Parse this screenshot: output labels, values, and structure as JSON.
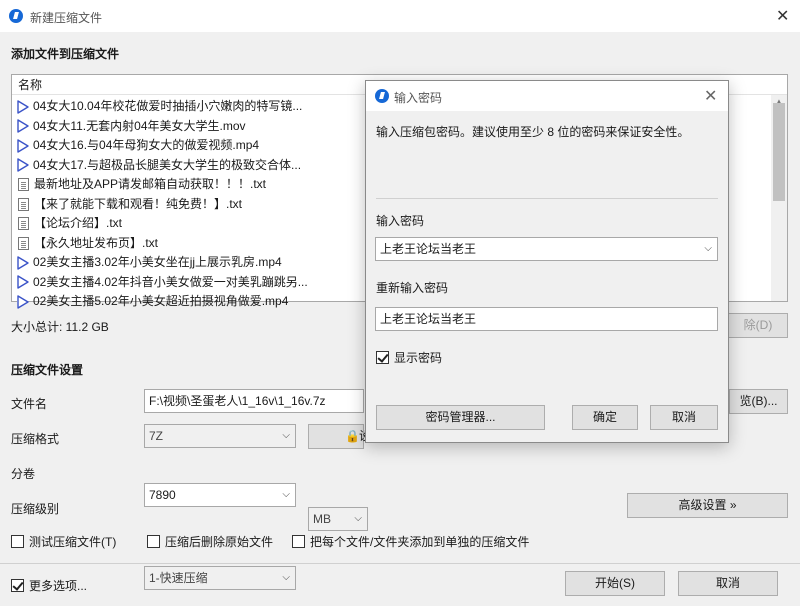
{
  "window": {
    "title": "新建压缩文件"
  },
  "section_add": "添加文件到压缩文件",
  "file_list": {
    "header": "名称",
    "items": [
      {
        "name": "04女大10.04年校花做爱时抽插小穴嫩肉的特写镜...",
        "type": "video"
      },
      {
        "name": "04女大11.无套内射04年美女大学生.mov",
        "type": "video"
      },
      {
        "name": "04女大16.与04年母狗女大的做爱视频.mp4",
        "type": "video"
      },
      {
        "name": "04女大17.与超极品长腿美女大学生的极致交合体...",
        "type": "video"
      },
      {
        "name": "最新地址及APP请发邮箱自动获取！！！.txt",
        "type": "text"
      },
      {
        "name": "【来了就能下载和观看！纯免费！】.txt",
        "type": "text"
      },
      {
        "name": "【论坛介绍】.txt",
        "type": "text"
      },
      {
        "name": "【永久地址发布页】.txt",
        "type": "text"
      },
      {
        "name": "02美女主播3.02年小美女坐在jj上展示乳房.mp4",
        "type": "video"
      },
      {
        "name": "02美女主播4.02年抖音小美女做爱一对美乳蹦跳另...",
        "type": "video"
      },
      {
        "name": "02美女主播5.02年小美女超近拍摄视角做爱.mp4",
        "type": "video"
      }
    ]
  },
  "total_size": "大小总计: 11.2 GB",
  "remove_button": "除(D)",
  "section_settings": "压缩文件设置",
  "settings": {
    "filename_label": "文件名",
    "filename_value": "F:\\视频\\圣蛋老人\\1_16v\\1_16v.7z",
    "browse_button": "览(B)...",
    "format_label": "压缩格式",
    "format_value": "7Z",
    "password_button": "设",
    "split_label": "分卷",
    "split_value": "7890",
    "split_unit": "MB",
    "level_label": "压缩级别",
    "level_value": "1-快速压缩",
    "advanced_button": "高级设置 »"
  },
  "options": {
    "test": "测试压缩文件(T)",
    "delete_original": "压缩后删除原始文件",
    "separate": "把每个文件/文件夹添加到单独的压缩文件"
  },
  "more_options": "更多选项...",
  "start_button": "开始(S)",
  "cancel_button": "取消",
  "password_dialog": {
    "title": "输入密码",
    "description": "输入压缩包密码。建议使用至少 8 位的密码来保证安全性。",
    "password_label": "输入密码",
    "password_value": "上老王论坛当老王",
    "confirm_label": "重新输入密码",
    "confirm_value": "上老王论坛当老王",
    "show_password": "显示密码",
    "manager_button": "密码管理器...",
    "ok_button": "确定",
    "cancel_button": "取消"
  },
  "colors": {
    "accent": "#1668d6",
    "video_icon": "#3a53c8"
  }
}
